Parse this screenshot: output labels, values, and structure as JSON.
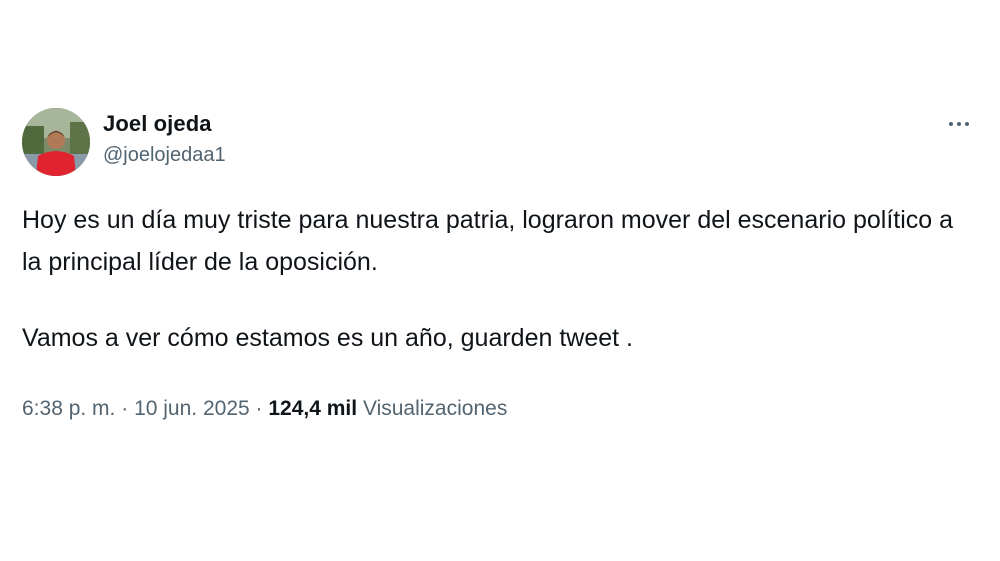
{
  "tweet": {
    "author": {
      "display_name": "Joel ojeda",
      "handle": "@joelojedaa1"
    },
    "more_icon": "more-horizontal-icon",
    "paragraphs": [
      "Hoy es un día muy triste para nuestra patria, lograron mover del escenario político a la principal líder de la oposición.",
      "Vamos a ver cómo estamos es un año, guarden tweet ."
    ],
    "meta": {
      "time": "6:38 p. m.",
      "separator": "·",
      "date": "10 jun. 2025",
      "views_count": "124,4 mil",
      "views_label": "Visualizaciones"
    }
  }
}
